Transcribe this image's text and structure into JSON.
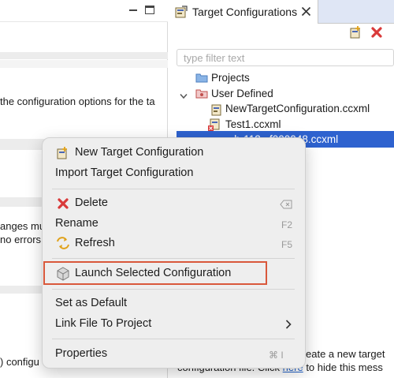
{
  "colors": {
    "accent": "#2e62cf",
    "highlight_border": "#d9583b",
    "delete_red": "#d93a3a"
  },
  "left_pane": {
    "config_text": "the configuration options for the ta",
    "changes_text": "anges mu",
    "errors_text": "no errors",
    "bottom_text": ") configu"
  },
  "panel": {
    "tab_title": "Target Configurations",
    "filter_placeholder": "type filter text",
    "tree": {
      "projects": "Projects",
      "user_defined": "User Defined",
      "items": [
        "NewTargetConfiguration.ccxml",
        "Test1.ccxml",
        "...b-112...f000048.ccxml"
      ]
    },
    "footer_text_1": "eate a new target",
    "footer_text_2_pre": "configuration file. Click ",
    "footer_link": "here",
    "footer_text_2_post": " to hide this mess"
  },
  "context_menu": {
    "new_target": "New Target Configuration",
    "import_target": "Import Target Configuration",
    "delete": "Delete",
    "rename": "Rename",
    "rename_shortcut": "F2",
    "refresh": "Refresh",
    "refresh_shortcut": "F5",
    "launch": "Launch Selected Configuration",
    "set_default": "Set as Default",
    "link_file": "Link File To Project",
    "properties": "Properties",
    "properties_shortcut": "⌘ I"
  }
}
